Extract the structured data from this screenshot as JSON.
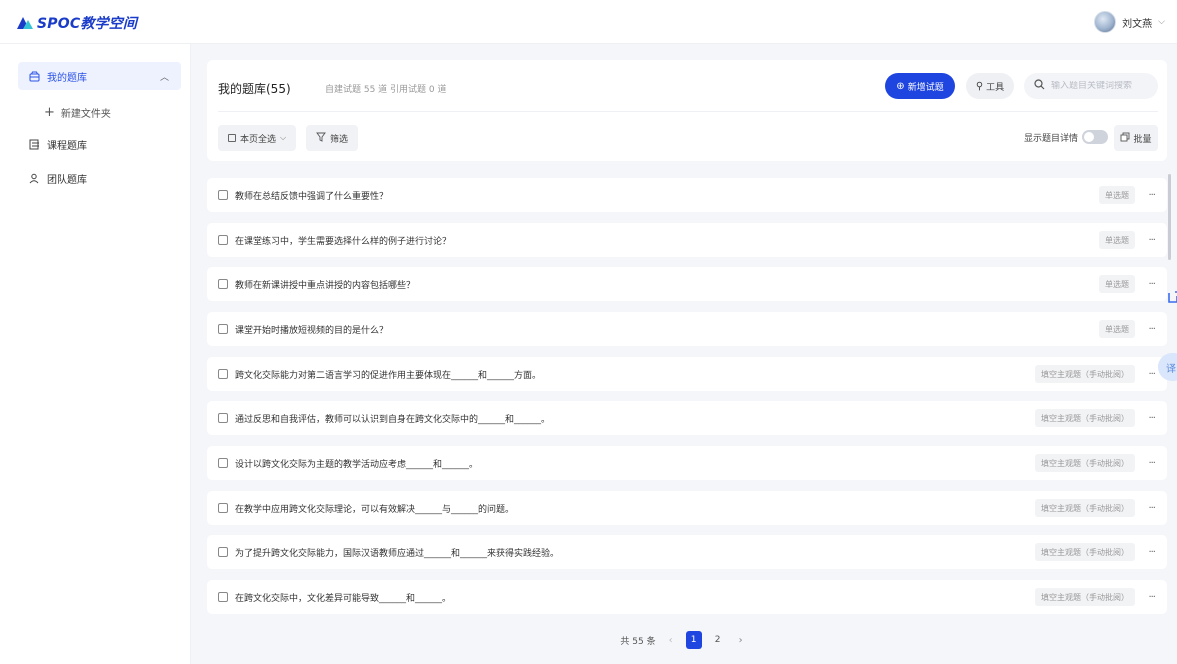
{
  "brand": {
    "logo_text": "SPOC教学空间"
  },
  "user": {
    "name": "刘文燕"
  },
  "sidebar": {
    "items": [
      {
        "label": "我的题库",
        "icon": "box-icon",
        "active": true
      },
      {
        "label": "课程题库",
        "icon": "book-icon",
        "active": false
      },
      {
        "label": "团队题库",
        "icon": "team-icon",
        "active": false
      }
    ],
    "sub_new_folder": "新建文件夹"
  },
  "header": {
    "title": "我的题库(55)",
    "subtitle": "自建试题 55 道  引用试题 0 道",
    "new_question": "新增试题",
    "tools": "工具",
    "search_placeholder": "输入题目关键词搜索",
    "select_page": "本页全选",
    "filter": "筛选",
    "show_details": "显示题目详情",
    "batch": "批量"
  },
  "questions": [
    {
      "text": "教师在总结反馈中强调了什么重要性？",
      "type": "单选题"
    },
    {
      "text": "在课堂练习中，学生需要选择什么样的例子进行讨论？",
      "type": "单选题"
    },
    {
      "text": "教师在新课讲授中重点讲授的内容包括哪些？",
      "type": "单选题"
    },
    {
      "text": "课堂开始时播放短视频的目的是什么？",
      "type": "单选题"
    },
    {
      "text": "跨文化交际能力对第二语言学习的促进作用主要体现在______和______方面。",
      "type": "填空主观题（手动批阅）"
    },
    {
      "text": "通过反思和自我评估，教师可以认识到自身在跨文化交际中的______和______。",
      "type": "填空主观题（手动批阅）"
    },
    {
      "text": "设计以跨文化交际为主题的教学活动应考虑______和______。",
      "type": "填空主观题（手动批阅）"
    },
    {
      "text": "在教学中应用跨文化交际理论，可以有效解决______与______的问题。",
      "type": "填空主观题（手动批阅）"
    },
    {
      "text": "为了提升跨文化交际能力，国际汉语教师应通过______和______来获得实践经验。",
      "type": "填空主观题（手动批阅）"
    },
    {
      "text": "在跨文化交际中，文化差异可能导致______和______。",
      "type": "填空主观题（手动批阅）"
    }
  ],
  "pagination": {
    "total": "共 55 条",
    "pages": [
      "1",
      "2"
    ],
    "current": "1"
  },
  "float_widget": {
    "label": "译"
  },
  "colors": {
    "accent": "#1f45e0",
    "sidebar_active_bg": "#eef2ff",
    "main_bg": "#f4f6f9"
  }
}
